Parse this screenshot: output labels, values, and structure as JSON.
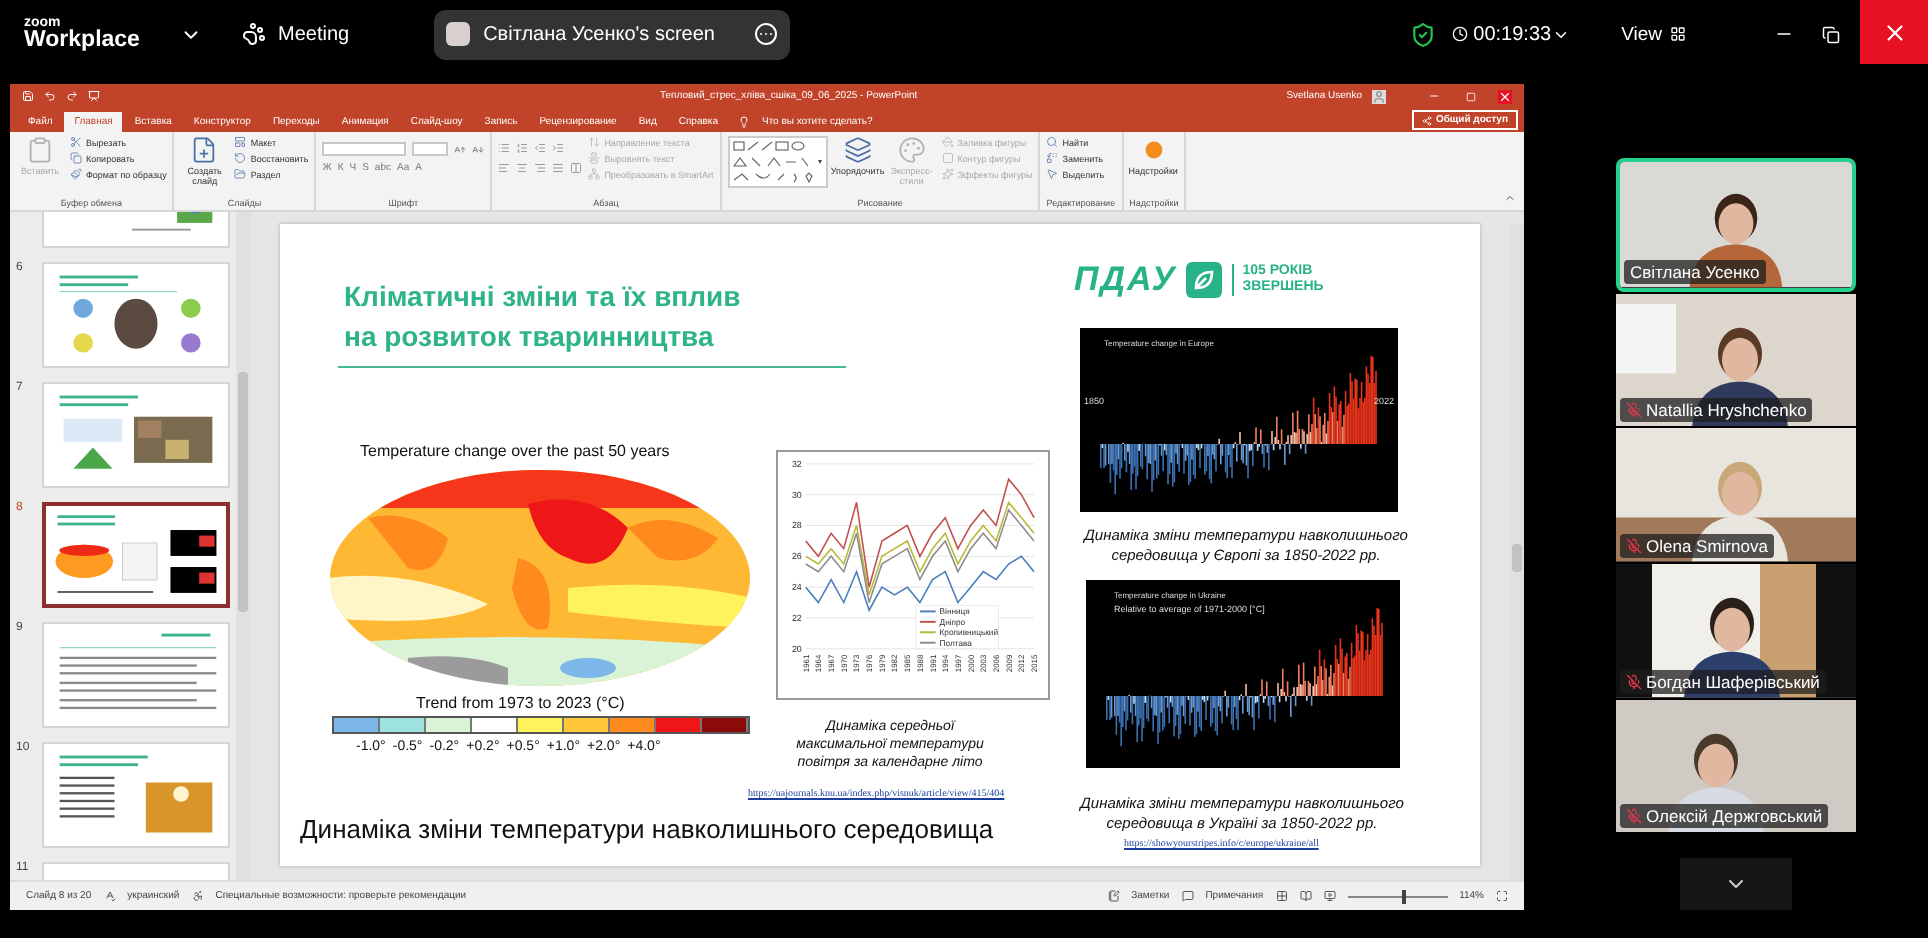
{
  "zoom": {
    "logo_small": "zoom",
    "logo_large": "Workplace",
    "meeting_label": "Meeting",
    "share_title": "Світлана Усенко's screen",
    "timer": "00:19:33",
    "view_label": "View"
  },
  "powerpoint": {
    "title": "Тепловий_стрес_хліва_сшіка_09_06_2025 - PowerPoint",
    "user": "Svetlana Usenko",
    "tabs": [
      {
        "label": "Файл",
        "selected": false
      },
      {
        "label": "Главная",
        "selected": true
      },
      {
        "label": "Вставка",
        "selected": false
      },
      {
        "label": "Конструктор",
        "selected": false
      },
      {
        "label": "Переходы",
        "selected": false
      },
      {
        "label": "Анимация",
        "selected": false
      },
      {
        "label": "Слайд-шоу",
        "selected": false
      },
      {
        "label": "Запись",
        "selected": false
      },
      {
        "label": "Рецензирование",
        "selected": false
      },
      {
        "label": "Вид",
        "selected": false
      },
      {
        "label": "Справка",
        "selected": false
      }
    ],
    "tell_me": "Что вы хотите сделать?",
    "share_button": "Общий доступ",
    "ribbon": [
      {
        "kind": "plain",
        "label": "Буфер обмена",
        "items": [
          {
            "kind": "large",
            "label": "Вставить",
            "disabled": true
          },
          {
            "kind": "small",
            "label": "Вырезать",
            "disabled": false
          },
          {
            "kind": "small",
            "label": "Копировать",
            "disabled": false
          },
          {
            "kind": "small",
            "label": "Формат по образцу",
            "disabled": false
          }
        ]
      },
      {
        "kind": "plain",
        "label": "Слайды",
        "items": [
          {
            "kind": "large",
            "label": "Создать слайд",
            "disabled": false
          },
          {
            "kind": "small",
            "label": "Макет",
            "disabled": false
          },
          {
            "kind": "small",
            "label": "Восстановить",
            "disabled": false
          },
          {
            "kind": "small",
            "label": "Раздел",
            "disabled": false
          }
        ]
      },
      {
        "kind": "font",
        "label": "Шрифт"
      },
      {
        "kind": "paragraph",
        "label": "Абзац",
        "items": [
          {
            "kind": "small",
            "label": "Направление текста",
            "disabled": true
          },
          {
            "kind": "small",
            "label": "Выровнять текст",
            "disabled": true
          },
          {
            "kind": "small",
            "label": "Преобразовать в SmartArt",
            "disabled": true
          }
        ]
      },
      {
        "kind": "drawing",
        "label": "Рисование",
        "items": [
          {
            "kind": "large",
            "label": "Упорядочить",
            "disabled": false
          },
          {
            "kind": "large",
            "label": "Экспресс-стили",
            "disabled": true
          },
          {
            "kind": "small",
            "label": "Заливка фигуры",
            "disabled": true
          },
          {
            "kind": "small",
            "label": "Контур фигуры",
            "disabled": true
          },
          {
            "kind": "small",
            "label": "Эффекты фигуры",
            "disabled": true
          }
        ]
      },
      {
        "kind": "plain",
        "label": "Редактирование",
        "items": [
          {
            "kind": "small",
            "label": "Найти",
            "disabled": false
          },
          {
            "kind": "small",
            "label": "Заменить",
            "disabled": false
          },
          {
            "kind": "small",
            "label": "Выделить",
            "disabled": false
          }
        ]
      },
      {
        "kind": "plain",
        "label": "Надстройки",
        "items": [
          {
            "kind": "large",
            "label": "Надстройки",
            "disabled": false
          }
        ]
      }
    ],
    "font_buttons": [
      "Ж",
      "К",
      "Ч",
      "S",
      "abc",
      "Aa",
      "A"
    ],
    "thumbnails": [
      {
        "kind": "text-image",
        "selected": false
      },
      {
        "number": "6",
        "kind": "diagram",
        "selected": false
      },
      {
        "number": "7",
        "kind": "table-image",
        "selected": false
      },
      {
        "number": "8",
        "kind": "charts",
        "selected": true
      },
      {
        "number": "9",
        "kind": "text",
        "selected": false
      },
      {
        "number": "10",
        "kind": "list-image",
        "selected": false
      },
      {
        "number": "11",
        "kind": "blank",
        "selected": false
      }
    ],
    "slide": {
      "title_lines": [
        "Кліматичні зміни та їх вплив",
        "на розвиток тваринництва"
      ],
      "logo_mark": "ПДАУ",
      "logo_text_lines": [
        "105 РОКІВ",
        "ЗВЕРШЕНЬ"
      ],
      "map": {
        "title": "Temperature change over the past 50 years",
        "trend_title": "Trend from 1973 to 2023 (°C)",
        "swatches": [
          {
            "color": "#7cb7e8"
          },
          {
            "color": "#9fe3e0"
          },
          {
            "color": "#d8f3d6"
          },
          {
            "color": "#ffffff"
          },
          {
            "color": "#fff35c"
          },
          {
            "color": "#ffc83a"
          },
          {
            "color": "#ff8a1e"
          },
          {
            "color": "#ee1616"
          },
          {
            "color": "#8b0a0a"
          }
        ],
        "labels": [
          "-1.0°",
          "-0.5°",
          "-0.2°",
          "+0.2°",
          "+0.5°",
          "+1.0°",
          "+2.0°",
          "+4.0°"
        ]
      },
      "line_chart": {
        "chart_data": {
          "type": "line",
          "grid": true,
          "legend": true,
          "x": [
            1961,
            1964,
            1967,
            1970,
            1973,
            1976,
            1979,
            1982,
            1985,
            1988,
            1991,
            1994,
            1997,
            2000,
            2003,
            2006,
            2009,
            2012,
            2015
          ],
          "xlim": [
            1961,
            2015
          ],
          "ylim": [
            20,
            32
          ],
          "yticks": [
            20,
            22,
            24,
            26,
            28,
            30,
            32
          ],
          "xticks": [
            1961,
            1964,
            1967,
            1970,
            1973,
            1976,
            1979,
            1982,
            1985,
            1988,
            1991,
            1994,
            1997,
            2000,
            2003,
            2006,
            2009,
            2012,
            2015
          ],
          "series": [
            {
              "name": "Вінниця",
              "color": "#4a7ebb",
              "values": [
                24,
                23,
                24.5,
                23,
                25,
                22.5,
                24,
                23.5,
                24,
                23,
                24.5,
                25,
                23,
                24,
                25,
                24.5,
                25.5,
                26,
                25
              ]
            },
            {
              "name": "Дніпро",
              "color": "#c0504d",
              "values": [
                27,
                26,
                27.5,
                26.5,
                29.5,
                24,
                27,
                27.5,
                28,
                26,
                27.5,
                28.5,
                26.5,
                28,
                29,
                28,
                31,
                30,
                28.5
              ]
            },
            {
              "name": "Кропивницький",
              "color": "#b8b83a",
              "values": [
                26,
                25.5,
                26.5,
                25.5,
                28,
                23.5,
                26,
                26.5,
                27,
                25,
                26.5,
                27.5,
                25.5,
                27,
                28,
                27,
                29.5,
                28.5,
                27.5
              ]
            },
            {
              "name": "Полтава",
              "color": "#8c8c8c",
              "values": [
                25.5,
                25,
                26,
                25,
                27.5,
                23,
                25.5,
                26,
                26.5,
                24.5,
                26,
                27,
                25,
                26.5,
                27.5,
                26.5,
                29,
                28,
                27
              ]
            }
          ]
        }
      },
      "line_caption_lines": [
        "Динаміка середньої",
        "максимальної температури",
        "повітря за календарне літо"
      ],
      "line_link": "https://uajournals.knu.ua/index.php/visnuk/article/view/415/404",
      "europe": {
        "title": "Temperature change in Europe",
        "start": "1850",
        "end": "2022",
        "caption_lines": [
          "Динаміка зміни температури навколишнього",
          "середовища у Європі за 1850-2022 рр."
        ]
      },
      "ukraine": {
        "title": "Temperature change in Ukraine",
        "subtitle": "Relative to average of 1971-2000 [°C]",
        "caption_lines": [
          "Динаміка зміни температури навколишнього",
          "середовища в Україні за 1850-2022 рр."
        ],
        "link": "https://showyourstripes.info/c/europe/ukraine/all"
      },
      "footer": "Динаміка зміни температури навколишнього середовища"
    },
    "status": {
      "slide": "Слайд 8 из 20",
      "language": "украинский",
      "accessibility": "Специальные возможности: проверьте рекомендации",
      "notes": "Заметки",
      "comments": "Примечания",
      "zoom": "114%",
      "zoom_slider": {
        "level": 0.55
      }
    }
  },
  "participants": [
    {
      "name": "Світлана Усенко",
      "muted": false,
      "speaking": true
    },
    {
      "name": "Natallia Hryshchenko",
      "muted": true,
      "speaking": false
    },
    {
      "name": "Olena Smirnova",
      "muted": true,
      "speaking": false
    },
    {
      "name": "Богдан Шаферівський",
      "muted": true,
      "speaking": false
    },
    {
      "name": "Олексій Держговський",
      "muted": true,
      "speaking": false
    }
  ]
}
